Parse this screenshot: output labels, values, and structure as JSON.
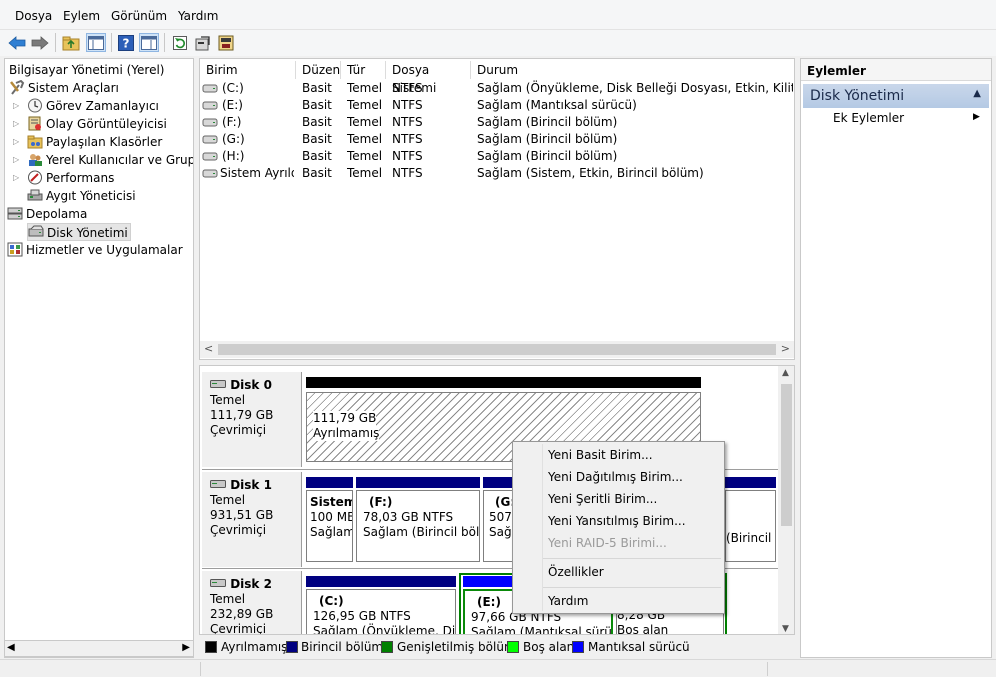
{
  "menu": [
    "Dosya",
    "Eylem",
    "Görünüm",
    "Yardım"
  ],
  "tree": {
    "root": "Bilgisayar Yönetimi (Yerel)",
    "items": [
      {
        "label": "Sistem Araçları",
        "icon": "tools-icon"
      },
      {
        "label": "Görev Zamanlayıcı",
        "icon": "clock-icon"
      },
      {
        "label": "Olay Görüntüleyicisi",
        "icon": "event-viewer-icon"
      },
      {
        "label": "Paylaşılan Klasörler",
        "icon": "shared-folder-icon"
      },
      {
        "label": "Yerel Kullanıcılar ve Gruplar",
        "icon": "users-icon"
      },
      {
        "label": "Performans",
        "icon": "performance-icon"
      },
      {
        "label": "Aygıt Yöneticisi",
        "icon": "device-manager-icon"
      },
      {
        "label": "Depolama",
        "icon": "storage-icon"
      },
      {
        "label": "Disk Yönetimi",
        "icon": "disk-icon"
      },
      {
        "label": "Hizmetler ve Uygulamalar",
        "icon": "services-icon"
      }
    ]
  },
  "volumes": {
    "headers": [
      "Birim",
      "Düzen",
      "Tür",
      "Dosya Sistemi",
      "Durum"
    ],
    "rows": [
      [
        "(C:)",
        "Basit",
        "Temel",
        "NTFS",
        "Sağlam (Önyükleme, Disk Belleği Dosyası, Etkin, Kilitlenme B"
      ],
      [
        "(E:)",
        "Basit",
        "Temel",
        "NTFS",
        "Sağlam (Mantıksal sürücü)"
      ],
      [
        "(F:)",
        "Basit",
        "Temel",
        "NTFS",
        "Sağlam (Birincil bölüm)"
      ],
      [
        "(G:)",
        "Basit",
        "Temel",
        "NTFS",
        "Sağlam (Birincil bölüm)"
      ],
      [
        "(H:)",
        "Basit",
        "Temel",
        "NTFS",
        "Sağlam (Birincil bölüm)"
      ],
      [
        "Sistem Ayrıldı",
        "Basit",
        "Temel",
        "NTFS",
        "Sağlam (Sistem, Etkin, Birincil bölüm)"
      ]
    ]
  },
  "disks": {
    "disk0": {
      "name": "Disk 0",
      "type": "Temel",
      "size": "111,79 GB",
      "status": "Çevrimiçi",
      "p0_size": "111,79 GB",
      "p0_status": "Ayrılmamış"
    },
    "disk1": {
      "name": "Disk 1",
      "type": "Temel",
      "size": "931,51 GB",
      "status": "Çevrimiçi",
      "p0_name": "Sistem",
      "p0_size": "100 MB",
      "p0_status": "Sağlam",
      "p1_name": "(F:)",
      "p1_size": "78,03 GB NTFS",
      "p1_status": "Sağlam (Birincil bölüm)",
      "p2_name": "(G:",
      "p2_size": "507,",
      "p2_status": "Sağlam",
      "p3_status": "(Birincil bölüm)"
    },
    "disk2": {
      "name": "Disk 2",
      "type": "Temel",
      "size": "232,89 GB",
      "status": "Çevrimiçi",
      "p0_name": "(C:)",
      "p0_size": "126,95 GB NTFS",
      "p0_status": "Sağlam (Önyükleme, Disk",
      "p1_name": "(E:)",
      "p1_size": "97,66 GB NTFS",
      "p1_status": "Sağlam (Mantıksal sürücü",
      "p2_size": "8,28 GB",
      "p2_status": "Boş alan"
    }
  },
  "legend": [
    {
      "label": "Ayrılmamış",
      "color": "#000000"
    },
    {
      "label": "Birincil bölüm",
      "color": "#000080"
    },
    {
      "label": "Genişletilmiş bölüm",
      "color": "#008000"
    },
    {
      "label": "Boş alan",
      "color": "#00ff00"
    },
    {
      "label": "Mantıksal sürücü",
      "color": "#0000ff"
    }
  ],
  "actions": {
    "title": "Eylemler",
    "section": "Disk Yönetimi",
    "more": "Ek Eylemler"
  },
  "context_menu": {
    "items": [
      "Yeni Basit Birim...",
      "Yeni Dağıtılmış Birim...",
      "Yeni Şeritli Birim...",
      "Yeni Yansıtılmış Birim...",
      "Yeni RAID-5 Birimi..."
    ],
    "disabled_index": 4,
    "properties": "Özellikler",
    "help": "Yardım"
  }
}
